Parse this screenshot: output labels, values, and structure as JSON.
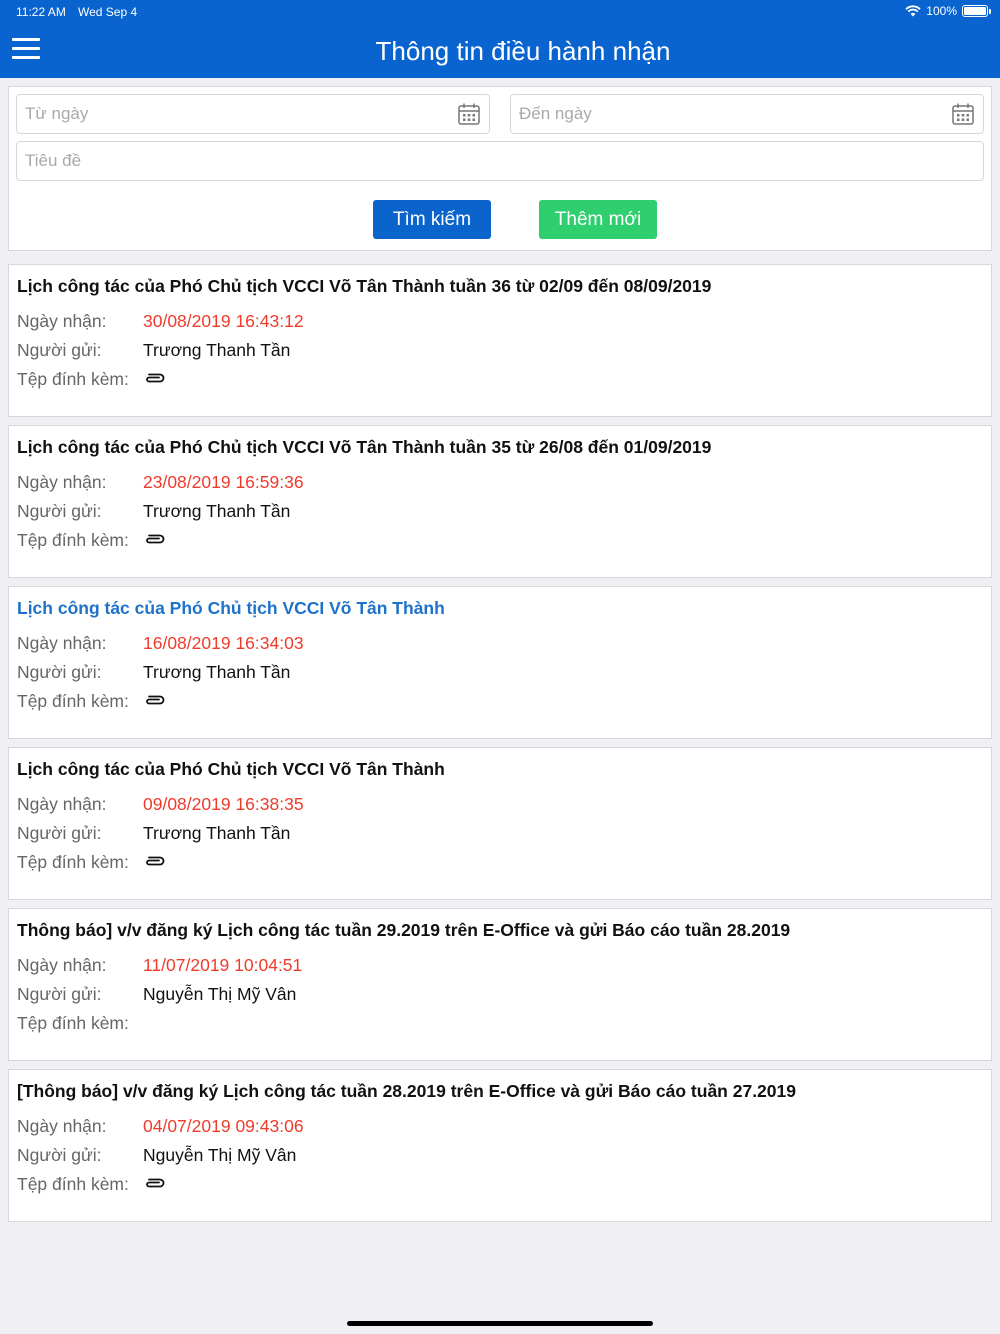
{
  "status_bar": {
    "time": "11:22 AM",
    "date": "Wed Sep 4",
    "battery": "100%"
  },
  "header": {
    "title": "Thông tin điều hành nhận",
    "menu_icon": "hamburger-menu-icon"
  },
  "search": {
    "from_date_placeholder": "Từ ngày",
    "to_date_placeholder": "Đến ngày",
    "title_placeholder": "Tiêu đề",
    "search_button": "Tìm kiếm",
    "add_button": "Thêm mới"
  },
  "labels": {
    "received": "Ngày nhận:",
    "sender": "Người gửi:",
    "attachment": "Tệp đính kèm:"
  },
  "items": [
    {
      "title": "Lịch công tác của Phó Chủ tịch VCCI Võ Tân Thành tuần 36 từ 02/09 đến 08/09/2019",
      "received": "30/08/2019 16:43:12",
      "sender": "Trương Thanh Tần",
      "has_attachment": true,
      "highlighted": false
    },
    {
      "title": "Lịch công tác của Phó Chủ tịch VCCI Võ Tân Thành tuần 35 từ 26/08 đến 01/09/2019",
      "received": "23/08/2019 16:59:36",
      "sender": "Trương Thanh Tần",
      "has_attachment": true,
      "highlighted": false
    },
    {
      "title": "Lịch công tác của Phó Chủ tịch VCCI Võ Tân Thành",
      "received": "16/08/2019 16:34:03",
      "sender": "Trương Thanh Tần",
      "has_attachment": true,
      "highlighted": true
    },
    {
      "title": "Lịch công tác của Phó Chủ tịch VCCI Võ Tân Thành",
      "received": "09/08/2019 16:38:35",
      "sender": "Trương Thanh Tần",
      "has_attachment": true,
      "highlighted": false
    },
    {
      "title": "Thông báo] v/v đăng ký Lịch công tác tuần 29.2019 trên E-Office và gửi Báo cáo tuần 28.2019",
      "received": "11/07/2019 10:04:51",
      "sender": "Nguyễn Thị Mỹ Vân",
      "has_attachment": false,
      "highlighted": false
    },
    {
      "title": "[Thông báo] v/v đăng ký Lịch công tác tuần 28.2019 trên E-Office và gửi Báo cáo tuần 27.2019",
      "received": "04/07/2019 09:43:06",
      "sender": "Nguyễn Thị Mỹ Vân",
      "has_attachment": true,
      "highlighted": false
    }
  ],
  "colors": {
    "primary": "#0a64cf",
    "add_green": "#2fcf6f",
    "date_red": "#ef3b2c",
    "highlight_blue": "#1e72c9"
  }
}
